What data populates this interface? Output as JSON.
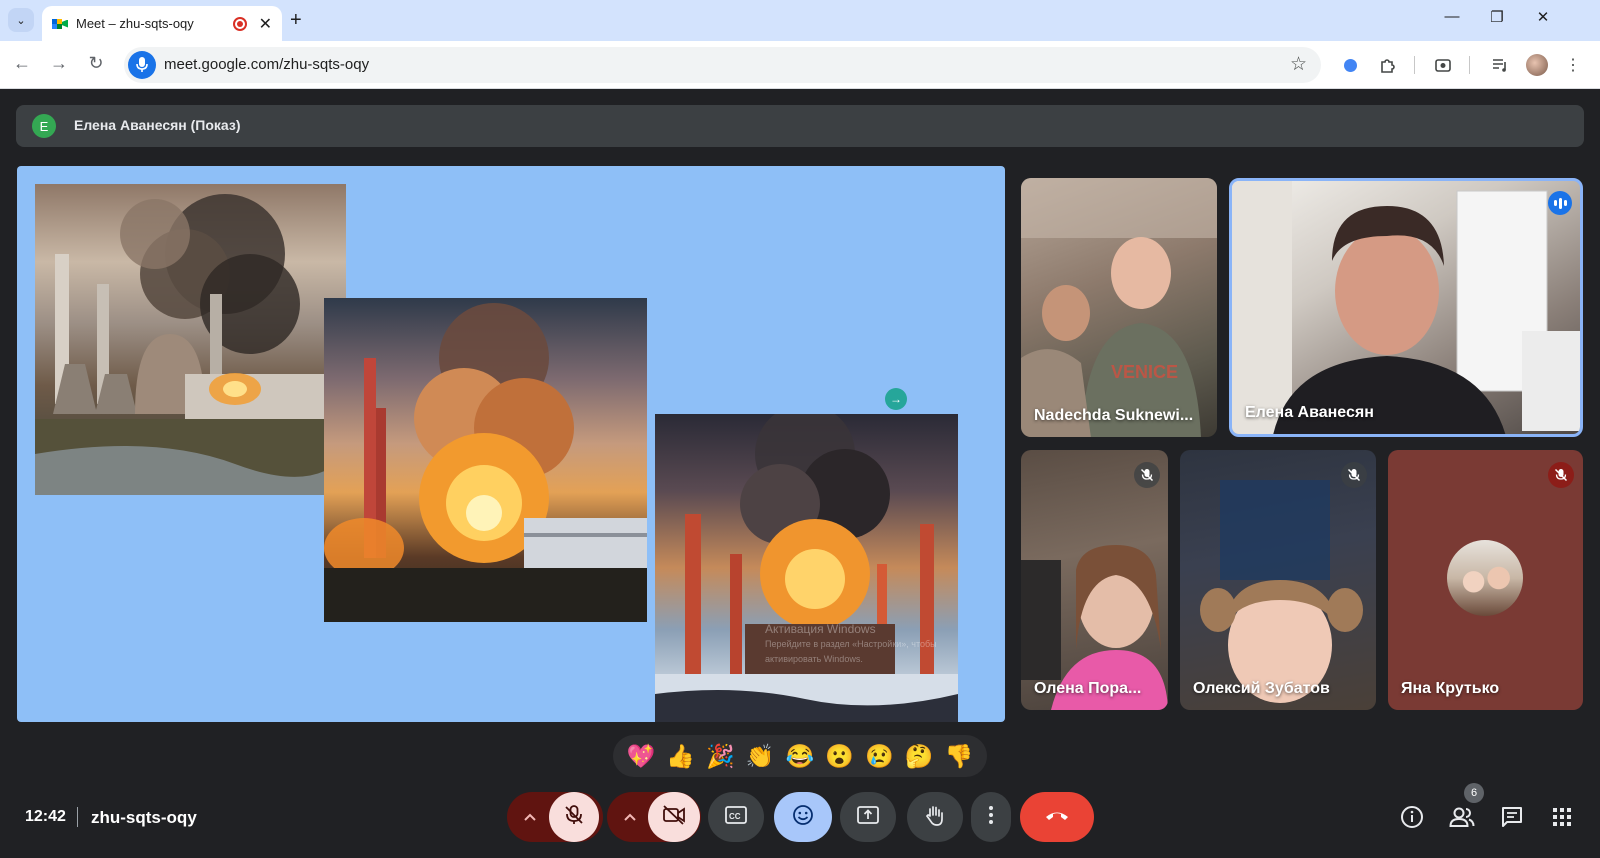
{
  "browser": {
    "tab_title": "Meet – zhu-sqts-oqy",
    "tab_close": "✕",
    "new_tab": "+",
    "tab_search": "⌄",
    "url": "meet.google.com/zhu-sqts-oqy",
    "window_controls": {
      "minimize": "—",
      "restore": "❐",
      "close": "✕"
    },
    "nav": {
      "back": "←",
      "forward": "→",
      "reload": "↻"
    },
    "star": "☆",
    "menu": "⋮"
  },
  "presenter": {
    "avatar_letter": "E",
    "label": "Елена Аванесян (Показ)",
    "avatar_color": "#34a853"
  },
  "slide": {
    "background": "#8ebff7",
    "watermark_title": "Активация Windows",
    "watermark_line1": "Перейдите в раздел «Настройки», чтобы",
    "watermark_line2": "активировать Windows.",
    "cursor_icon": "→"
  },
  "participants": [
    {
      "name": "Nadechda Suknewi...",
      "muted": false,
      "speaking": false
    },
    {
      "name": "Елена Аванесян",
      "muted": false,
      "speaking": true
    },
    {
      "name": "Олена Пора...",
      "muted": true,
      "speaking": false
    },
    {
      "name": "Олексий Зубатов",
      "muted": true,
      "speaking": false
    },
    {
      "name": "Яна Крутько",
      "muted": true,
      "speaking": false
    }
  ],
  "reactions": [
    "💖",
    "👍",
    "🎉",
    "👏",
    "😂",
    "😮",
    "😢",
    "🤔",
    "👎"
  ],
  "footer": {
    "time": "12:42",
    "meeting_code": "zhu-sqts-oqy",
    "people_count": "6"
  },
  "colors": {
    "meet_bg": "#202124",
    "end_call": "#ea4335",
    "muted_ctrl": "#f9dedc",
    "active_ctrl": "#a8c7fa",
    "speaking": "#1a73e8"
  },
  "icons": {
    "mic_off": "mic-off-icon",
    "camera_off": "videocam-off-icon",
    "captions": "closed-captions-icon",
    "emoji": "emoji-icon",
    "present": "present-screen-icon",
    "hand": "raise-hand-icon",
    "more": "more-options-icon",
    "end_call": "call-end-icon",
    "info": "info-icon",
    "people": "people-icon",
    "chat": "chat-icon",
    "activities": "apps-grid-icon"
  }
}
